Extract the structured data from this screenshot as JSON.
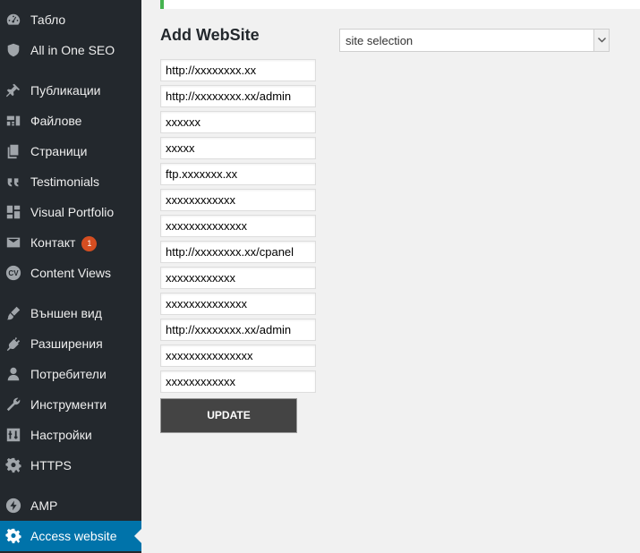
{
  "sidebar": {
    "items": [
      {
        "label": "Табло",
        "icon": "dashboard-icon"
      },
      {
        "label": "All in One SEO",
        "icon": "shield-icon"
      },
      {
        "label": "Публикации",
        "icon": "pin-icon"
      },
      {
        "label": "Файлове",
        "icon": "media-icon"
      },
      {
        "label": "Страници",
        "icon": "pages-icon"
      },
      {
        "label": "Testimonials",
        "icon": "quote-icon"
      },
      {
        "label": "Visual Portfolio",
        "icon": "grid-icon"
      },
      {
        "label": "Контакт",
        "icon": "envelope-icon",
        "badge": "1"
      },
      {
        "label": "Content Views",
        "icon": "cv-icon"
      },
      {
        "label": "Външен вид",
        "icon": "brush-icon"
      },
      {
        "label": "Разширения",
        "icon": "plug-icon"
      },
      {
        "label": "Потребители",
        "icon": "user-icon"
      },
      {
        "label": "Инструменти",
        "icon": "wrench-icon"
      },
      {
        "label": "Настройки",
        "icon": "settings-sliders-icon"
      },
      {
        "label": "HTTPS",
        "icon": "gear-icon"
      },
      {
        "label": "AMP",
        "icon": "bolt-icon"
      },
      {
        "label": "Access website",
        "icon": "gear-icon",
        "active": true
      }
    ]
  },
  "main": {
    "title": "Add WebSite",
    "fields": [
      "http://xxxxxxxx.xx",
      "http://xxxxxxxx.xx/admin",
      "xxxxxx",
      "xxxxx",
      "ftp.xxxxxxx.xx",
      "xxxxxxxxxxxx",
      "xxxxxxxxxxxxxx",
      "http://xxxxxxxx.xx/cpanel",
      "xxxxxxxxxxxx",
      "xxxxxxxxxxxxxx",
      "http://xxxxxxxx.xx/admin",
      "xxxxxxxxxxxxxxx",
      "xxxxxxxxxxxx"
    ],
    "update_label": "UPDATE",
    "site_select": {
      "selected": "site selection"
    }
  },
  "colors": {
    "sidebar_bg": "#23282d",
    "active_bg": "#0073aa",
    "badge": "#d54e21",
    "notice_border": "#46b450",
    "button_bg": "#444444"
  }
}
